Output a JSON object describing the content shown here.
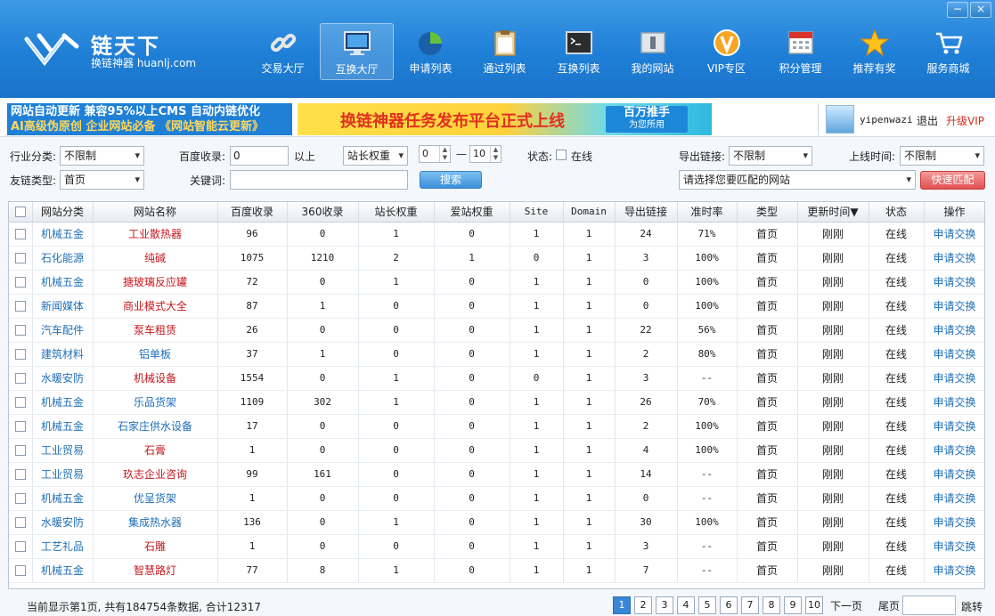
{
  "window": {
    "minimize_label": "−",
    "close_label": "×"
  },
  "logo": {
    "title": "链天下",
    "subtitle": "换链神器 huanlj.com"
  },
  "nav": [
    {
      "label": "交易大厅",
      "icon": "link-icon"
    },
    {
      "label": "互换大厅",
      "icon": "monitor-icon"
    },
    {
      "label": "申请列表",
      "icon": "pie-chart-icon"
    },
    {
      "label": "通过列表",
      "icon": "clipboard-icon"
    },
    {
      "label": "互换列表",
      "icon": "terminal-icon"
    },
    {
      "label": "我的网站",
      "icon": "window-icon"
    },
    {
      "label": "VIP专区",
      "icon": "vip-icon"
    },
    {
      "label": "积分管理",
      "icon": "calendar-icon"
    },
    {
      "label": "推荐有奖",
      "icon": "star-icon"
    },
    {
      "label": "服务商城",
      "icon": "cart-icon"
    }
  ],
  "banner": {
    "left_line1": "网站自动更新  兼容95%以上CMS  自动内链优化",
    "left_line2": "AI高级伪原创  企业网站必备 《网站智能云更新》",
    "center_main": "换链神器任务发布平台正式上线",
    "center_badge1": "百万推手",
    "center_badge2": "为您所用"
  },
  "user": {
    "name": "yipenwazi",
    "logout": "退出",
    "upgrade": "升级VIP"
  },
  "filters": {
    "industry_label": "行业分类:",
    "industry_value": "不限制",
    "baidu_label": "百度收录:",
    "baidu_value": "0",
    "baidu_suffix": "以上",
    "weight_type": "站长权重",
    "weight_min": "0",
    "weight_dash": "—",
    "weight_max": "10",
    "status_label": "状态:",
    "status_online": "在线",
    "export_label": "导出链接:",
    "export_value": "不限制",
    "online_time_label": "上线时间:",
    "online_time_value": "不限制",
    "link_type_label": "友链类型:",
    "link_type_value": "首页",
    "keyword_label": "关键词:",
    "keyword_value": "",
    "search_button": "搜索",
    "match_site_value": "请选择您要匹配的网站",
    "match_button": "快速匹配"
  },
  "table": {
    "columns": [
      "网站分类",
      "网站名称",
      "百度收录",
      "360收录",
      "站长权重",
      "爱站权重",
      "Site",
      "Domain",
      "导出链接",
      "准时率",
      "类型",
      "更新时间▼",
      "状态",
      "操作"
    ],
    "rows": [
      [
        "机械五金",
        "工业散热器",
        "96",
        "0",
        "1",
        "0",
        "1",
        "1",
        "24",
        "71%",
        "首页",
        "刚刚",
        "在线",
        "申请交换"
      ],
      [
        "石化能源",
        "纯碱",
        "1075",
        "1210",
        "2",
        "1",
        "0",
        "1",
        "3",
        "100%",
        "首页",
        "刚刚",
        "在线",
        "申请交换"
      ],
      [
        "机械五金",
        "搪玻璃反应罐",
        "72",
        "0",
        "1",
        "0",
        "1",
        "1",
        "0",
        "100%",
        "首页",
        "刚刚",
        "在线",
        "申请交换"
      ],
      [
        "新闻媒体",
        "商业模式大全",
        "87",
        "1",
        "0",
        "0",
        "1",
        "1",
        "0",
        "100%",
        "首页",
        "刚刚",
        "在线",
        "申请交换"
      ],
      [
        "汽车配件",
        "泵车租赁",
        "26",
        "0",
        "0",
        "0",
        "1",
        "1",
        "22",
        "56%",
        "首页",
        "刚刚",
        "在线",
        "申请交换"
      ],
      [
        "建筑材料",
        "铝单板",
        "37",
        "1",
        "0",
        "0",
        "1",
        "1",
        "2",
        "80%",
        "首页",
        "刚刚",
        "在线",
        "申请交换"
      ],
      [
        "水暖安防",
        "机械设备",
        "1554",
        "0",
        "1",
        "0",
        "0",
        "1",
        "3",
        "--",
        "首页",
        "刚刚",
        "在线",
        "申请交换"
      ],
      [
        "机械五金",
        "乐品货架",
        "1109",
        "302",
        "1",
        "0",
        "1",
        "1",
        "26",
        "70%",
        "首页",
        "刚刚",
        "在线",
        "申请交换"
      ],
      [
        "机械五金",
        "石家庄供水设备",
        "17",
        "0",
        "0",
        "0",
        "1",
        "1",
        "2",
        "100%",
        "首页",
        "刚刚",
        "在线",
        "申请交换"
      ],
      [
        "工业贸易",
        "石膏",
        "1",
        "0",
        "0",
        "0",
        "1",
        "1",
        "4",
        "100%",
        "首页",
        "刚刚",
        "在线",
        "申请交换"
      ],
      [
        "工业贸易",
        "玖志企业咨询",
        "99",
        "161",
        "0",
        "0",
        "1",
        "1",
        "14",
        "--",
        "首页",
        "刚刚",
        "在线",
        "申请交换"
      ],
      [
        "机械五金",
        "优呈货架",
        "1",
        "0",
        "0",
        "0",
        "1",
        "1",
        "0",
        "--",
        "首页",
        "刚刚",
        "在线",
        "申请交换"
      ],
      [
        "水暖安防",
        "集成热水器",
        "136",
        "0",
        "1",
        "0",
        "1",
        "1",
        "30",
        "100%",
        "首页",
        "刚刚",
        "在线",
        "申请交换"
      ],
      [
        "工艺礼品",
        "石雕",
        "1",
        "0",
        "0",
        "0",
        "1",
        "1",
        "3",
        "--",
        "首页",
        "刚刚",
        "在线",
        "申请交换"
      ],
      [
        "机械五金",
        "智慧路灯",
        "77",
        "8",
        "1",
        "0",
        "1",
        "1",
        "7",
        "--",
        "首页",
        "刚刚",
        "在线",
        "申请交换"
      ]
    ],
    "name_colors": [
      "red",
      "red",
      "red",
      "red",
      "red",
      "blue",
      "red",
      "blue",
      "blue",
      "red",
      "red",
      "blue",
      "blue",
      "red",
      "red"
    ]
  },
  "footer": {
    "info": "当前显示第1页, 共有184754条数据, 合计12317",
    "pages": [
      "1",
      "2",
      "3",
      "4",
      "5",
      "6",
      "7",
      "8",
      "9",
      "10"
    ],
    "current_page": "1",
    "next": "下一页",
    "last": "尾页",
    "goto": "跳转"
  }
}
